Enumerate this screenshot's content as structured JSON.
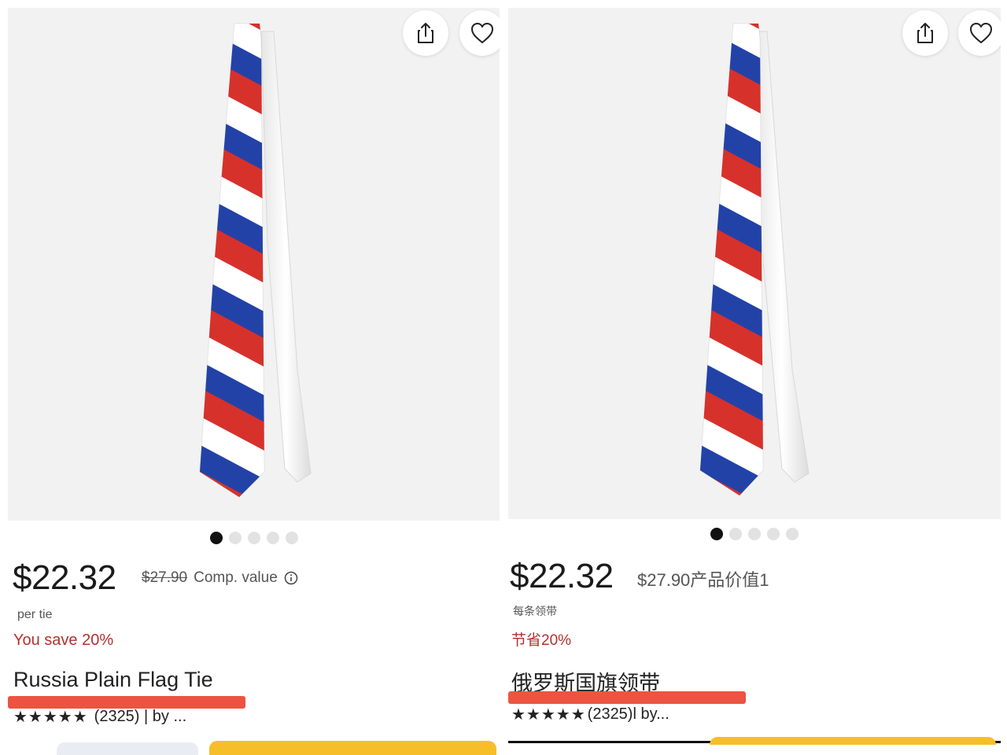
{
  "left": {
    "price": "$22.32",
    "old_price": "$27.90",
    "comp_label": "Comp. value",
    "info_icon": "info-icon",
    "per_unit": "per tie",
    "savings": "You save 20%",
    "title": "Russia Plain Flag Tie",
    "stars": "★★★★★",
    "rating_text": "(2325) | by ..."
  },
  "right": {
    "price": "$22.32",
    "comp_text": "$27.90产品价值1",
    "per_unit": "每条领带",
    "savings": "节省20%",
    "title": "俄罗斯国旗领带",
    "stars": "★★★★★",
    "rating_text": "(2325)l by..."
  },
  "icons": {
    "share": "share-icon",
    "favorite": "heart-icon"
  },
  "carousel": {
    "count": 5,
    "active_index": 0
  },
  "colors": {
    "tie_red": "#d7312b",
    "tie_blue": "#2342a8",
    "tie_white": "#ffffff",
    "save_red": "#b3312e",
    "highlight_bar": "#ec5441",
    "cta_yellow": "#f6bf2a"
  }
}
